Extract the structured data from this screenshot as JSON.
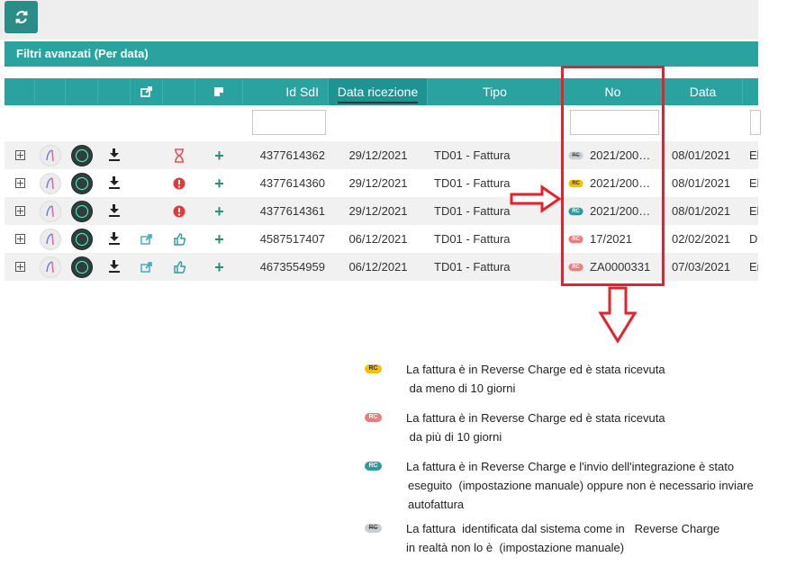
{
  "toolbar": {
    "refresh_icon": "refresh-icon"
  },
  "filters": {
    "label": "Filtri avanzati  (Per data)"
  },
  "grid": {
    "columns": {
      "share_icon": "share-icon",
      "note_icon": "note-icon",
      "id_sdi": "Id SdI",
      "data_ricezione": "Data ricezione",
      "tipo": "Tipo",
      "no": "No",
      "data": "Data"
    },
    "rows": [
      {
        "id": "4377614362",
        "data_ricezione": "29/12/2021",
        "tipo": "TD01 - Fattura",
        "badge": "RC",
        "badge_color": "grey",
        "no": "2021/200…",
        "data": "08/01/2021",
        "extra": "El",
        "share": "",
        "status": "hourglass-icon"
      },
      {
        "id": "4377614360",
        "data_ricezione": "29/12/2021",
        "tipo": "TD01 - Fattura",
        "badge": "RC",
        "badge_color": "yellow",
        "no": "2021/200…",
        "data": "08/01/2021",
        "extra": "El",
        "share": "",
        "status": "alert-icon"
      },
      {
        "id": "4377614361",
        "data_ricezione": "29/12/2021",
        "tipo": "TD01 - Fattura",
        "badge": "RC",
        "badge_color": "teal",
        "no": "2021/200…",
        "data": "08/01/2021",
        "extra": "El",
        "share": "",
        "status": "alert-icon"
      },
      {
        "id": "4587517407",
        "data_ricezione": "06/12/2021",
        "tipo": "TD01 - Fattura",
        "badge": "RC",
        "badge_color": "red",
        "no": "17/2021",
        "data": "02/02/2021",
        "extra": "D",
        "share": "share-icon",
        "status": "thumbs-up-icon"
      },
      {
        "id": "4673554959",
        "data_ricezione": "06/12/2021",
        "tipo": "TD01 - Fattura",
        "badge": "RC",
        "badge_color": "red",
        "no": "ZA0000331",
        "data": "07/03/2021",
        "extra": "Er",
        "share": "share-icon",
        "status": "thumbs-up-icon"
      }
    ]
  },
  "legend": [
    {
      "badge": "RC",
      "color": "yellow",
      "line1": "La fattura è in Reverse Charge ed è stata ricevuta",
      "line2": " da meno di 10 giorni",
      "line3": ""
    },
    {
      "badge": "RC",
      "color": "red",
      "line1": "La fattura è in Reverse Charge ed è stata ricevuta",
      "line2": " da più di 10 giorni",
      "line3": ""
    },
    {
      "badge": "RC",
      "color": "teal",
      "line1": "La fattura è in Reverse Charge e l'invio dell'integrazione è stato",
      "line2": "eseguito  (impostazione manuale) oppure non è necessario inviare",
      "line3": "autofattura"
    },
    {
      "badge": "RC",
      "color": "grey",
      "line1": "La fattura  identificata dal sistema come in   Reverse Charge",
      "line2": "in realtà non lo è  (impostazione manuale)",
      "line3": ""
    }
  ],
  "colors": {
    "teal": "#2aa2a0",
    "red_highlight": "#e8202a",
    "rc_yellow": "#f2c200",
    "rc_red": "#ef7b7b",
    "rc_teal": "#2a9d9a",
    "rc_grey": "#c9cdd4"
  }
}
